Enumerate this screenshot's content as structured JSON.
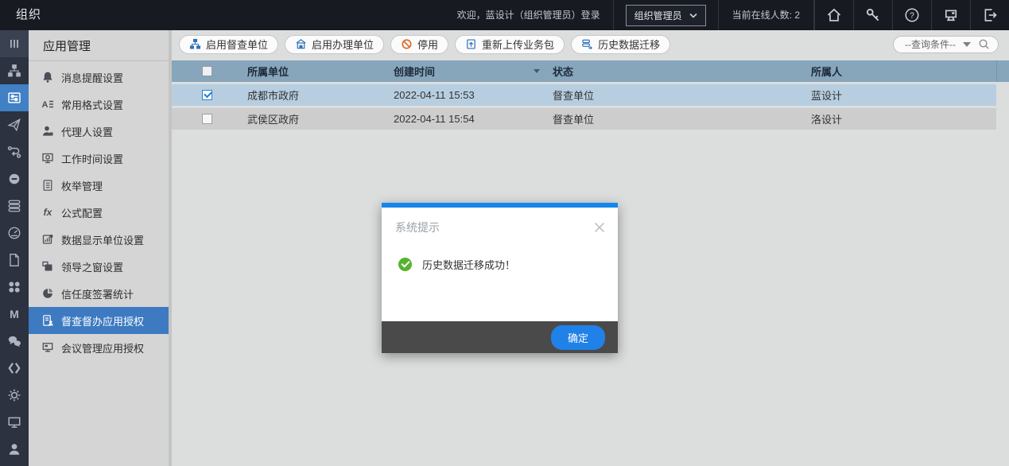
{
  "topbar": {
    "title": "组织",
    "welcome": "欢迎，蓝设计（组织管理员）登录",
    "role_dropdown": "组织管理员",
    "online_count": "当前在线人数: 2",
    "icons": [
      "home-icon",
      "key-icon",
      "help-icon",
      "workstation-icon",
      "logout-icon"
    ]
  },
  "rail": {
    "icons": [
      "collapse-icon",
      "org-tree-icon",
      "app-settings-icon",
      "send-icon",
      "workflow-icon",
      "badge-icon",
      "database-icon",
      "dashboard-icon",
      "document-icon",
      "apps-grid-icon",
      "letter-m-icon",
      "chat-icon",
      "code-icon",
      "gear-icon",
      "monitor-icon",
      "user-icon"
    ],
    "active_icon": "app-settings-icon"
  },
  "sidebar": {
    "title": "应用管理",
    "items": [
      {
        "icon": "bell-icon",
        "label": "消息提醒设置",
        "active": false
      },
      {
        "icon": "format-icon",
        "label": "常用格式设置",
        "active": false
      },
      {
        "icon": "agent-icon",
        "label": "代理人设置",
        "active": false
      },
      {
        "icon": "worktime-icon",
        "label": "工作时间设置",
        "active": false
      },
      {
        "icon": "enum-icon",
        "label": "枚举管理",
        "active": false
      },
      {
        "icon": "formula-icon",
        "label": "公式配置",
        "active": false
      },
      {
        "icon": "data-unit-icon",
        "label": "数据显示单位设置",
        "active": false
      },
      {
        "icon": "leader-window-icon",
        "label": "领导之窗设置",
        "active": false
      },
      {
        "icon": "trust-pie-icon",
        "label": "信任度签署统计",
        "active": false
      },
      {
        "icon": "supervise-icon",
        "label": "督查督办应用授权",
        "active": true
      },
      {
        "icon": "meeting-icon",
        "label": "会议管理应用授权",
        "active": false
      }
    ]
  },
  "toolbar": {
    "buttons": [
      {
        "icon": "enable-supervise-unit-icon",
        "label": "启用督查单位",
        "icon_color": "#2e74b8"
      },
      {
        "icon": "enable-handle-unit-icon",
        "label": "启用办理单位",
        "icon_color": "#2e74b8"
      },
      {
        "icon": "disable-icon",
        "label": "停用",
        "icon_color": "#d2702a"
      },
      {
        "icon": "reupload-package-icon",
        "label": "重新上传业务包",
        "icon_color": "#2e74b8"
      },
      {
        "icon": "history-migrate-icon",
        "label": "历史数据迁移",
        "icon_color": "#2e74b8"
      }
    ],
    "query_label": "--查询条件--"
  },
  "table": {
    "columns": [
      "所属单位",
      "创建时间",
      "状态",
      "所属人"
    ],
    "sorted_column": "创建时间",
    "rows": [
      {
        "checked": true,
        "selected": true,
        "unit": "成都市政府",
        "created": "2022-04-11 15:53",
        "status": "督查单位",
        "owner": "蓝设计"
      },
      {
        "checked": false,
        "selected": false,
        "unit": "武侯区政府",
        "created": "2022-04-11 15:54",
        "status": "督查单位",
        "owner": "洛设计"
      }
    ]
  },
  "modal": {
    "title": "系统提示",
    "message": "历史数据迁移成功！",
    "ok_label": "确定"
  },
  "colors": {
    "accent_blue": "#3d7ac1",
    "table_header": "#87a5bb",
    "selected_row": "#b7cee0",
    "success_green": "#57b32e",
    "modal_accent": "#1486ec",
    "ok_button": "#2081e8",
    "disable_orange": "#d2702a",
    "topbar_bg": "#171a21",
    "rail_bg": "#2c323f"
  }
}
